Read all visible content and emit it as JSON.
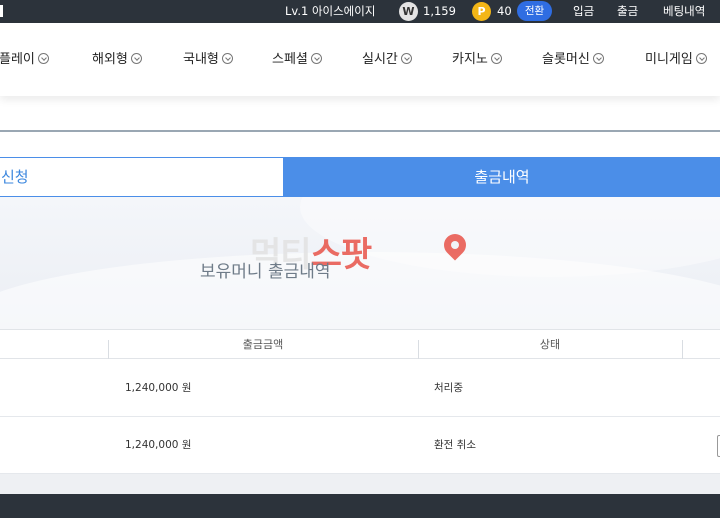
{
  "topbar": {
    "user_level": "Lv.1 아이스에이지",
    "wallet_icon": "W",
    "wallet_amount": "1,159",
    "point_icon": "P",
    "point_amount": "40",
    "convert_label": "전환",
    "deposit_label": "입금",
    "withdraw_label": "출금",
    "betting_history_label": "베팅내역"
  },
  "nav": {
    "items": [
      {
        "label": "플레이"
      },
      {
        "label": "해외형"
      },
      {
        "label": "국내형"
      },
      {
        "label": "스페셜"
      },
      {
        "label": "실시간"
      },
      {
        "label": "카지노"
      },
      {
        "label": "슬롯머신"
      },
      {
        "label": "미니게임"
      }
    ]
  },
  "tabs": {
    "request_label": "신청",
    "history_label": "출금내역"
  },
  "banner": {
    "title": "보유머니 출금내역",
    "watermark_a": "먹티",
    "watermark_b": "스팟"
  },
  "table": {
    "headers": {
      "amount": "출금금액",
      "status": "상태"
    },
    "rows": [
      {
        "amount": "1,240,000 원",
        "status": "처리중"
      },
      {
        "amount": "1,240,000 원",
        "status": "환전 취소"
      }
    ]
  },
  "colors": {
    "accent": "#4b8ee8",
    "topbar_bg": "#2c333b",
    "coin_point": "#f3b617",
    "convert_button": "#2f6de2"
  }
}
